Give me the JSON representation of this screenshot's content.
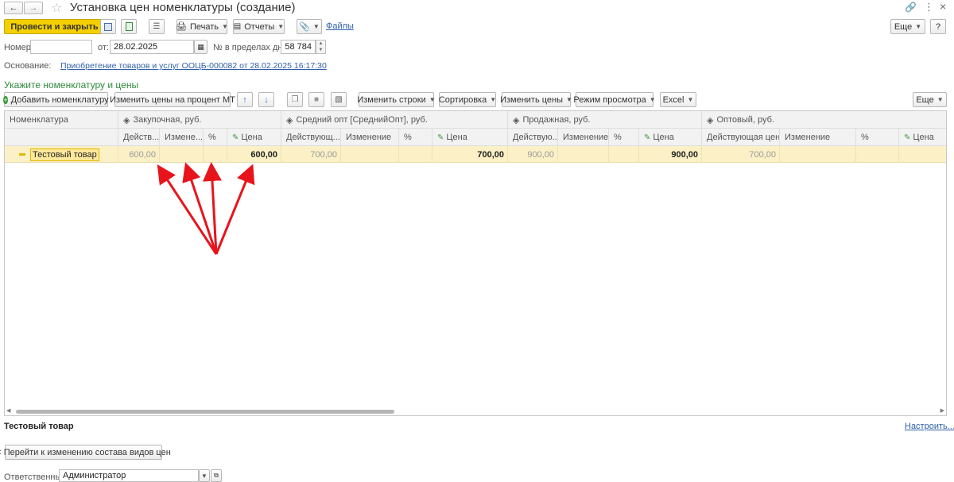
{
  "window": {
    "title": "Установка цен номенклатуры (создание)"
  },
  "toolbar": {
    "post_close": "Провести и закрыть",
    "print": "Печать",
    "reports": "Отчеты",
    "files": "Файлы",
    "more": "Еще",
    "help": "?"
  },
  "form": {
    "number_label": "Номер:",
    "number_value": "",
    "date_label": "от:",
    "date_value": "28.02.2025",
    "within_days_label": "№ в пределах дня:",
    "within_days_value": "58 784",
    "basis_label": "Основание:",
    "basis_link": "Приобретение товаров и услуг ООЦБ-000082 от 28.02.2025 16:17:30"
  },
  "section": {
    "title": "Укажите номенклатуру и цены",
    "add_item": "Добавить номенклатуру",
    "change_percent": "Изменить цены на процент МТ",
    "change_rows": "Изменить строки",
    "sorting": "Сортировка",
    "change_prices": "Изменить цены",
    "view_mode": "Режим просмотра",
    "excel": "Excel",
    "more": "Еще"
  },
  "table": {
    "header_item": "Номенклатура",
    "groups": [
      "Закупочная, руб.",
      "Средний опт [СреднийОпт], руб.",
      "Продажная, руб.",
      "Оптовый, руб."
    ],
    "sub_headers": [
      [
        "Действ...",
        "Измене...",
        "%",
        "Цена"
      ],
      [
        "Действующ...",
        "Изменение",
        "%",
        "Цена"
      ],
      [
        "Действую...",
        "Изменение",
        "%",
        "Цена"
      ],
      [
        "Действующая цена",
        "Изменение",
        "%",
        "Цена"
      ]
    ],
    "row": {
      "item": "Тестовый товар",
      "values": [
        [
          "600,00",
          "",
          "",
          "600,00"
        ],
        [
          "700,00",
          "",
          "",
          "700,00"
        ],
        [
          "900,00",
          "",
          "",
          "900,00"
        ],
        [
          "700,00",
          "",
          "",
          ""
        ]
      ]
    }
  },
  "footer": {
    "current_item": "Тестовый товар",
    "configure": "Настроить...",
    "go_to_change": "< Перейти к изменению состава видов цен",
    "responsible_label": "Ответственный:",
    "responsible_value": "Администратор"
  },
  "colors": {
    "accent_button": "#f5d000",
    "row_highlight": "#fbf0c6",
    "arrow": "#e8141c",
    "link": "#2f5fa8",
    "section_title": "#2e8b3a"
  }
}
